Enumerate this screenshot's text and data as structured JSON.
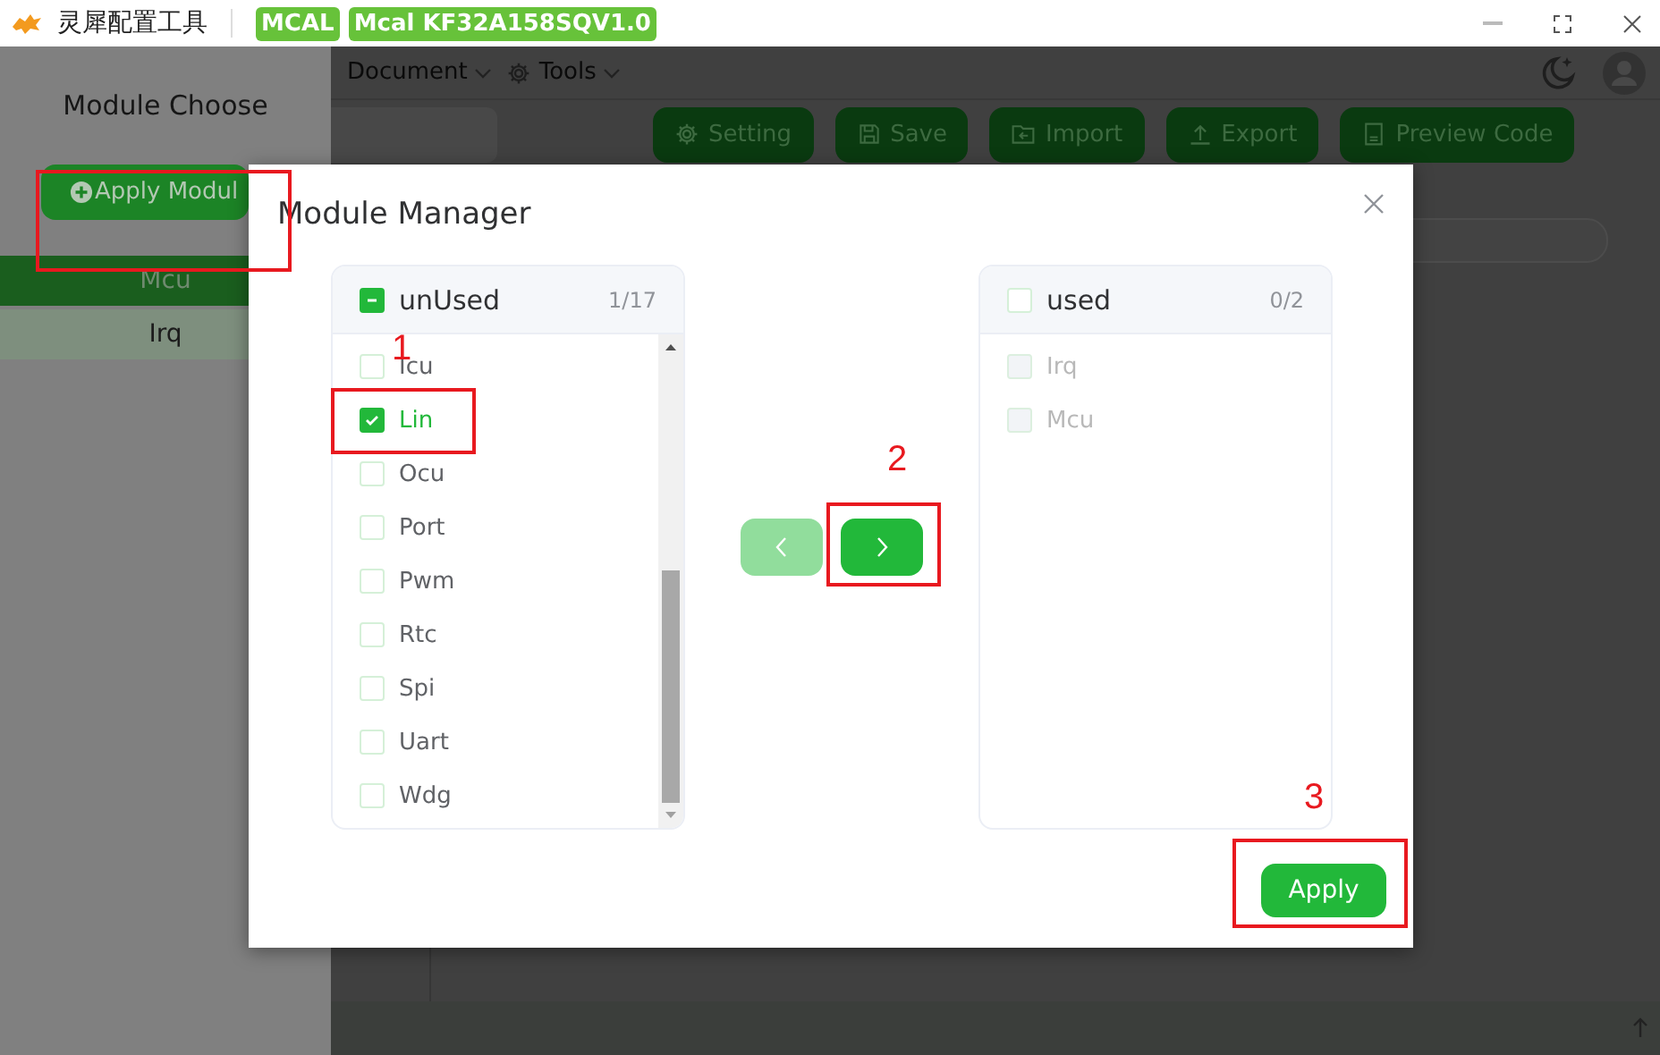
{
  "app": {
    "title": "灵犀配置工具",
    "tags": [
      "MCAL",
      "Mcal KF32A158SQV1.0"
    ]
  },
  "menu": [
    {
      "label": "Document",
      "kind": "plain"
    },
    {
      "label": "Tools",
      "kind": "gear"
    }
  ],
  "toolbar": {
    "buttons": [
      {
        "label": "Setting",
        "kind": "gear"
      },
      {
        "label": "Save",
        "kind": "save"
      },
      {
        "label": "Import",
        "kind": "import"
      },
      {
        "label": "Export",
        "kind": "export"
      },
      {
        "label": "Preview Code",
        "kind": "doc"
      }
    ]
  },
  "sidebar": {
    "title": "Module Choose",
    "apply_button": "Apply Modul",
    "items": [
      {
        "label": "Mcu",
        "selected": true
      },
      {
        "label": "Irq",
        "selected": false
      }
    ]
  },
  "dialog": {
    "title": "Module Manager",
    "source": {
      "title": "unUsed",
      "count": "1/17",
      "checked": false,
      "indeterminate": true,
      "items": [
        {
          "label": "Icu",
          "checked": false,
          "disabled": false
        },
        {
          "label": "Lin",
          "checked": true,
          "disabled": false
        },
        {
          "label": "Ocu",
          "checked": false,
          "disabled": false
        },
        {
          "label": "Port",
          "checked": false,
          "disabled": false
        },
        {
          "label": "Pwm",
          "checked": false,
          "disabled": false
        },
        {
          "label": "Rtc",
          "checked": false,
          "disabled": false
        },
        {
          "label": "Spi",
          "checked": false,
          "disabled": false
        },
        {
          "label": "Uart",
          "checked": false,
          "disabled": false
        },
        {
          "label": "Wdg",
          "checked": false,
          "disabled": false
        }
      ]
    },
    "target": {
      "title": "used",
      "count": "0/2",
      "checked": false,
      "indeterminate": false,
      "items": [
        {
          "label": "Irq",
          "checked": false,
          "disabled": true
        },
        {
          "label": "Mcu",
          "checked": false,
          "disabled": true
        }
      ]
    },
    "move_left": {
      "disabled": true
    },
    "move_right": {
      "disabled": false
    },
    "apply": "Apply"
  },
  "annotations": [
    {
      "number": "1"
    },
    {
      "number": "2"
    },
    {
      "number": "3"
    }
  ]
}
